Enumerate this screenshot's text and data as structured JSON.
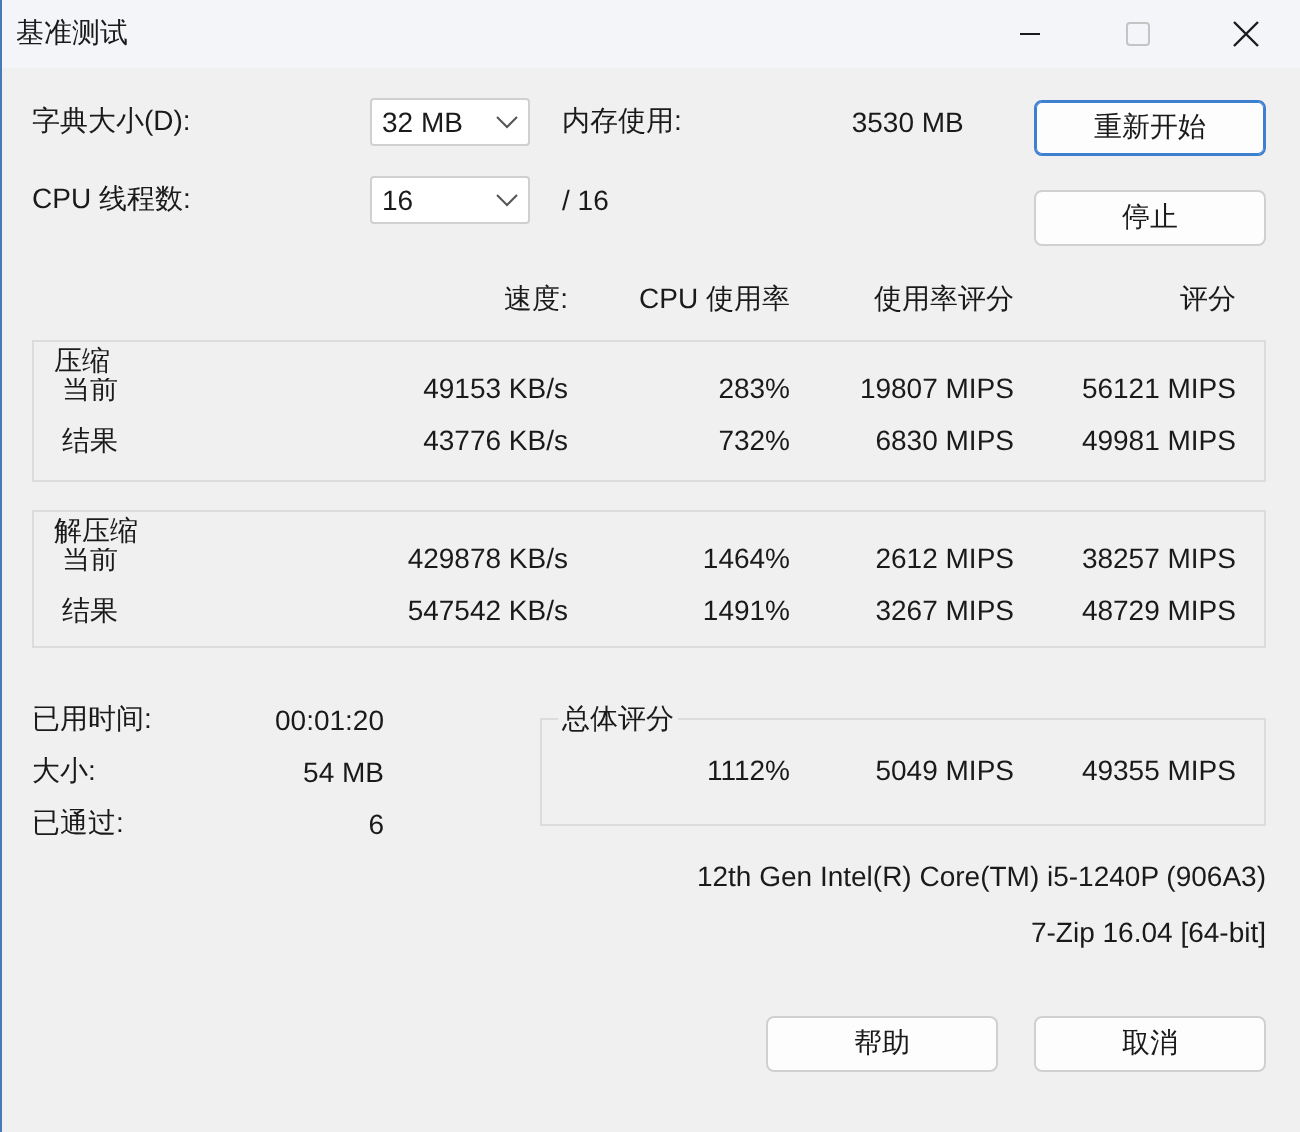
{
  "window": {
    "title": "基准测试",
    "controls": [
      {
        "kind": "minimize",
        "disabled": false
      },
      {
        "kind": "maximize",
        "disabled": true
      },
      {
        "kind": "close",
        "disabled": false
      }
    ]
  },
  "settings": [
    {
      "label": "字典大小(D):",
      "value": "32 MB"
    },
    {
      "label": "CPU 线程数:",
      "value": "16"
    }
  ],
  "memory": {
    "label": "内存使用:",
    "value": "3530 MB"
  },
  "threads_total": "/ 16",
  "side_buttons": [
    {
      "label": "重新开始",
      "default": true
    },
    {
      "label": "停止",
      "default": false
    }
  ],
  "columns": [
    "速度:",
    "CPU 使用率",
    "使用率评分",
    "评分"
  ],
  "groups": [
    {
      "title": "压缩",
      "rows": [
        {
          "label": "当前",
          "cells": [
            "49153 KB/s",
            "283%",
            "19807 MIPS",
            "56121 MIPS"
          ]
        },
        {
          "label": "结果",
          "cells": [
            "43776 KB/s",
            "732%",
            "6830 MIPS",
            "49981 MIPS"
          ]
        }
      ]
    },
    {
      "title": "解压缩",
      "rows": [
        {
          "label": "当前",
          "cells": [
            "429878 KB/s",
            "1464%",
            "2612 MIPS",
            "38257 MIPS"
          ]
        },
        {
          "label": "结果",
          "cells": [
            "547542 KB/s",
            "1491%",
            "3267 MIPS",
            "48729 MIPS"
          ]
        }
      ]
    }
  ],
  "stats": [
    {
      "label": "已用时间:",
      "value": "00:01:20"
    },
    {
      "label": "大小:",
      "value": "54 MB"
    },
    {
      "label": "已通过:",
      "value": "6"
    }
  ],
  "total": {
    "title": "总体评分",
    "cells": [
      "1112%",
      "5049 MIPS",
      "49355 MIPS"
    ]
  },
  "cpu": "12th Gen Intel(R) Core(TM) i5-1240P (906A3)",
  "version": "7-Zip 16.04 [64-bit]",
  "buttons": [
    {
      "label": "帮助",
      "default": false
    },
    {
      "label": "取消",
      "default": false
    }
  ]
}
